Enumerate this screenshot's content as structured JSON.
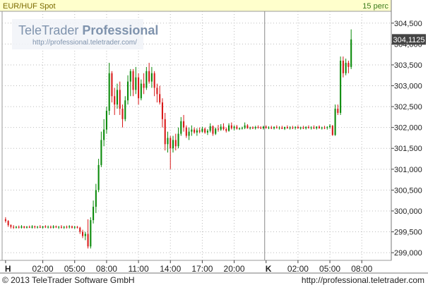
{
  "header": {
    "instrument": "EUR/HUF Spot",
    "interval": "15 perc"
  },
  "watermark": {
    "brand_plain": "TeleTrader",
    "brand_bold": "Professional",
    "url": "http://professional.teletrader.com/"
  },
  "footer": {
    "copyright": "© 2013 TeleTrader Software GmbH",
    "url": "http://professional.teletrader.com"
  },
  "last_price_label": "304,1125",
  "colors": {
    "background": "#ffffff",
    "header_bg": "#ffffcc",
    "up": "#0a8a0a",
    "down": "#d81818",
    "grid": "#bbbbbb",
    "last_price_box": "#444444"
  },
  "chart_data": {
    "type": "candlestick",
    "y_tick_labels": [
      "299,000",
      "299,500",
      "300,000",
      "300,500",
      "301,000",
      "301,500",
      "302,000",
      "302,500",
      "303,000",
      "303,500",
      "304,000",
      "304,500"
    ],
    "y_ticks": [
      299.0,
      299.5,
      300.0,
      300.5,
      301.0,
      301.5,
      302.0,
      302.5,
      303.0,
      303.5,
      304.0,
      304.5
    ],
    "ylim": [
      298.85,
      304.75
    ],
    "x_tick_labels": [
      "H",
      "02:00",
      "05:00",
      "08:00",
      "11:00",
      "14:00",
      "17:00",
      "20:00",
      "K",
      "02:00",
      "05:00",
      "08:00"
    ],
    "x_ticks": [
      0,
      14,
      26,
      38,
      50,
      62,
      74,
      86,
      98,
      110,
      122,
      134
    ],
    "day_separators": [
      0,
      98
    ],
    "xlim": [
      0,
      143
    ],
    "bars": [
      [
        299.8,
        299.85,
        299.72,
        299.76
      ],
      [
        299.76,
        299.78,
        299.62,
        299.66
      ],
      [
        299.66,
        299.68,
        299.58,
        299.62
      ],
      [
        299.62,
        299.66,
        299.57,
        299.6
      ],
      [
        299.6,
        299.64,
        299.58,
        299.62
      ],
      [
        299.62,
        299.65,
        299.58,
        299.6
      ],
      [
        299.6,
        299.66,
        299.58,
        299.63
      ],
      [
        299.63,
        299.64,
        299.58,
        299.6
      ],
      [
        299.6,
        299.64,
        299.58,
        299.62
      ],
      [
        299.62,
        299.65,
        299.59,
        299.6
      ],
      [
        299.6,
        299.66,
        299.58,
        299.63
      ],
      [
        299.63,
        299.65,
        299.58,
        299.61
      ],
      [
        299.61,
        299.64,
        299.58,
        299.62
      ],
      [
        299.62,
        299.66,
        299.59,
        299.6
      ],
      [
        299.6,
        299.64,
        299.58,
        299.63
      ],
      [
        299.63,
        299.66,
        299.59,
        299.61
      ],
      [
        299.61,
        299.65,
        299.58,
        299.62
      ],
      [
        299.62,
        299.65,
        299.58,
        299.6
      ],
      [
        299.6,
        299.66,
        299.58,
        299.63
      ],
      [
        299.63,
        299.65,
        299.59,
        299.61
      ],
      [
        299.61,
        299.64,
        299.57,
        299.62
      ],
      [
        299.62,
        299.66,
        299.58,
        299.6
      ],
      [
        299.6,
        299.64,
        299.57,
        299.62
      ],
      [
        299.62,
        299.65,
        299.58,
        299.61
      ],
      [
        299.61,
        299.66,
        299.58,
        299.63
      ],
      [
        299.63,
        299.65,
        299.58,
        299.6
      ],
      [
        299.6,
        299.64,
        299.57,
        299.62
      ],
      [
        299.62,
        299.64,
        299.58,
        299.6
      ],
      [
        299.6,
        299.62,
        299.45,
        299.5
      ],
      [
        299.5,
        299.55,
        299.35,
        299.4
      ],
      [
        299.4,
        299.5,
        299.3,
        299.45
      ],
      [
        299.45,
        299.8,
        299.1,
        299.15
      ],
      [
        299.15,
        299.85,
        299.1,
        299.78
      ],
      [
        299.78,
        300.25,
        299.7,
        300.1
      ],
      [
        300.1,
        300.65,
        299.95,
        300.5
      ],
      [
        300.5,
        301.25,
        300.45,
        301.1
      ],
      [
        301.1,
        301.9,
        301.05,
        301.7
      ],
      [
        301.7,
        302.2,
        301.55,
        301.95
      ],
      [
        301.95,
        302.5,
        301.85,
        302.4
      ],
      [
        302.4,
        303.55,
        302.3,
        303.3
      ],
      [
        303.3,
        303.35,
        302.6,
        302.75
      ],
      [
        302.75,
        302.95,
        302.3,
        302.55
      ],
      [
        302.55,
        303.05,
        302.45,
        302.9
      ],
      [
        302.9,
        303.1,
        302.3,
        302.45
      ],
      [
        302.45,
        302.55,
        302.0,
        302.2
      ],
      [
        302.2,
        302.75,
        302.15,
        302.65
      ],
      [
        302.65,
        303.25,
        302.55,
        303.1
      ],
      [
        303.1,
        303.4,
        302.75,
        303.35
      ],
      [
        303.35,
        303.4,
        302.75,
        302.9
      ],
      [
        302.9,
        303.45,
        302.8,
        303.2
      ],
      [
        303.2,
        303.3,
        302.55,
        302.7
      ],
      [
        302.7,
        303.15,
        302.65,
        303.05
      ],
      [
        303.05,
        303.3,
        302.8,
        302.95
      ],
      [
        302.95,
        303.45,
        302.9,
        303.35
      ],
      [
        303.35,
        303.55,
        303.05,
        303.1
      ],
      [
        303.1,
        303.45,
        302.95,
        303.3
      ],
      [
        303.3,
        303.35,
        302.75,
        302.95
      ],
      [
        302.95,
        303.05,
        302.6,
        302.8
      ],
      [
        302.8,
        303.0,
        302.55,
        302.6
      ],
      [
        302.6,
        302.7,
        302.0,
        302.2
      ],
      [
        302.2,
        302.35,
        301.45,
        301.6
      ],
      [
        301.6,
        301.9,
        301.4,
        301.75
      ],
      [
        301.75,
        301.8,
        301.0,
        301.5
      ],
      [
        301.5,
        301.8,
        301.4,
        301.7
      ],
      [
        301.7,
        301.85,
        301.45,
        301.55
      ],
      [
        301.55,
        302.0,
        301.5,
        301.85
      ],
      [
        301.85,
        302.25,
        301.8,
        302.15
      ],
      [
        302.15,
        302.3,
        301.9,
        302.0
      ],
      [
        302.0,
        302.05,
        301.75,
        301.8
      ],
      [
        301.8,
        302.0,
        301.7,
        301.9
      ],
      [
        301.9,
        302.05,
        301.8,
        301.95
      ],
      [
        301.95,
        302.0,
        301.85,
        301.88
      ],
      [
        301.88,
        301.98,
        301.8,
        301.93
      ],
      [
        301.93,
        302.0,
        301.86,
        301.9
      ],
      [
        301.9,
        302.02,
        301.88,
        301.97
      ],
      [
        301.97,
        302.0,
        301.85,
        301.88
      ],
      [
        301.88,
        301.96,
        301.82,
        301.92
      ],
      [
        301.92,
        302.1,
        301.88,
        302.03
      ],
      [
        302.03,
        302.05,
        301.8,
        301.85
      ],
      [
        301.85,
        302.0,
        301.82,
        301.97
      ],
      [
        301.97,
        302.06,
        301.9,
        301.95
      ],
      [
        301.95,
        302.08,
        301.92,
        302.02
      ],
      [
        302.02,
        302.1,
        301.93,
        301.96
      ],
      [
        301.96,
        302.0,
        301.88,
        301.92
      ],
      [
        301.92,
        302.1,
        301.9,
        302.05
      ],
      [
        302.05,
        302.12,
        301.95,
        301.98
      ],
      [
        301.98,
        302.05,
        301.93,
        302.02
      ],
      [
        302.02,
        302.06,
        301.95,
        301.97
      ],
      [
        301.97,
        302.0,
        301.94,
        301.98
      ],
      [
        301.98,
        302.02,
        301.95,
        301.99
      ],
      [
        301.99,
        302.12,
        301.96,
        302.05
      ],
      [
        302.05,
        302.08,
        301.97,
        301.98
      ],
      [
        301.98,
        302.02,
        301.95,
        302.0
      ],
      [
        302.0,
        302.03,
        301.96,
        301.98
      ],
      [
        301.98,
        302.04,
        301.95,
        302.01
      ],
      [
        302.01,
        302.05,
        301.97,
        302.0
      ],
      [
        302.0,
        302.03,
        301.96,
        301.98
      ],
      [
        301.98,
        302.04,
        301.95,
        302.02
      ],
      [
        302.02,
        302.05,
        301.97,
        301.99
      ],
      [
        301.99,
        302.03,
        301.96,
        302.0
      ],
      [
        302.0,
        302.04,
        301.96,
        301.98
      ],
      [
        301.98,
        302.03,
        301.95,
        302.01
      ],
      [
        302.01,
        302.05,
        301.97,
        301.99
      ],
      [
        301.99,
        302.03,
        301.95,
        302.0
      ],
      [
        302.0,
        302.04,
        301.96,
        301.97
      ],
      [
        301.97,
        302.02,
        301.94,
        302.01
      ],
      [
        302.01,
        302.05,
        301.97,
        301.98
      ],
      [
        301.98,
        302.03,
        301.95,
        302.0
      ],
      [
        302.0,
        302.04,
        301.96,
        301.99
      ],
      [
        301.99,
        302.03,
        301.95,
        302.01
      ],
      [
        302.01,
        302.05,
        301.97,
        301.98
      ],
      [
        301.98,
        302.02,
        301.95,
        302.0
      ],
      [
        302.0,
        302.04,
        301.96,
        301.98
      ],
      [
        301.98,
        302.03,
        301.95,
        302.01
      ],
      [
        302.01,
        302.05,
        301.97,
        301.99
      ],
      [
        301.99,
        302.03,
        301.95,
        302.0
      ],
      [
        302.0,
        302.05,
        301.96,
        301.98
      ],
      [
        301.98,
        302.03,
        301.95,
        302.02
      ],
      [
        302.02,
        302.05,
        301.97,
        301.98
      ],
      [
        301.98,
        302.02,
        301.95,
        302.0
      ],
      [
        302.0,
        302.04,
        301.96,
        301.99
      ],
      [
        301.99,
        302.03,
        301.95,
        302.01
      ],
      [
        302.01,
        302.08,
        301.97,
        302.04
      ],
      [
        302.04,
        302.06,
        301.8,
        301.82
      ],
      [
        301.82,
        302.55,
        301.8,
        302.45
      ],
      [
        302.45,
        302.55,
        302.3,
        302.35
      ],
      [
        302.35,
        303.7,
        302.3,
        303.6
      ],
      [
        303.6,
        303.7,
        303.2,
        303.3
      ],
      [
        303.3,
        303.65,
        303.25,
        303.55
      ],
      [
        303.55,
        303.6,
        303.3,
        303.45
      ],
      [
        303.45,
        304.35,
        303.4,
        304.11
      ]
    ]
  }
}
